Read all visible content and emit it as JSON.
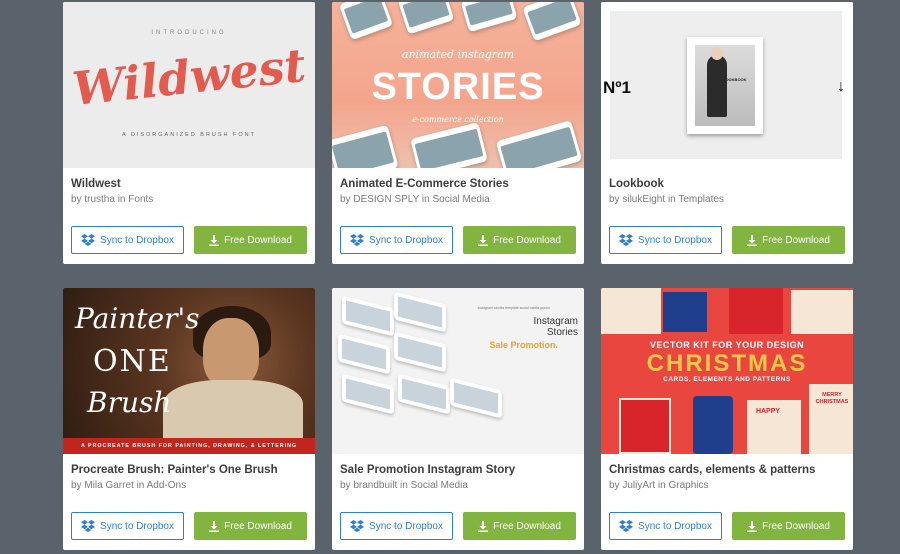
{
  "cards": [
    {
      "title": "Wildwest",
      "author": "trustha",
      "category": "Fonts",
      "sync_label": "Sync to Dropbox",
      "download_label": "Free Download",
      "thumb": {
        "intro": "INTRODUCING",
        "headline": "Wildwest",
        "sub": "A DISORGANIZED BRUSH FONT"
      }
    },
    {
      "title": "Animated E-Commerce Stories",
      "author": "DESIGN SPLY",
      "category": "Social Media",
      "sync_label": "Sync to Dropbox",
      "download_label": "Free Download",
      "thumb": {
        "line1": "animated instagram",
        "headline": "STORIES",
        "line3": "e-commerce collection"
      }
    },
    {
      "title": "Lookbook",
      "author": "silukEight",
      "category": "Templates",
      "sync_label": "Sync to Dropbox",
      "download_label": "Free Download",
      "thumb": {
        "number": "Nº1",
        "arrow": "↓",
        "cover": "LOOKBOOK"
      }
    },
    {
      "title": "Procreate Brush: Painter's One Brush",
      "author": "Mila Garret",
      "category": "Add-Ons",
      "sync_label": "Sync to Dropbox",
      "download_label": "Free Download",
      "thumb": {
        "w1": "Painter's",
        "w2": "ONE",
        "w3": "Brush",
        "banner": "A PROCREATE BRUSH FOR PAINTING, DRAWING, & LETTERING"
      }
    },
    {
      "title": "Sale Promotion Instagram Story",
      "author": "brandbuilt",
      "category": "Social Media",
      "sync_label": "Sync to Dropbox",
      "download_label": "Free Download",
      "thumb": {
        "small": "instagram stories template social media promo",
        "line1": "Instagram",
        "line2": "Stories",
        "promo": "Sale Promotion."
      }
    },
    {
      "title": "Christmas cards, elements & patterns",
      "author": "JuliyArt",
      "category": "Graphics",
      "sync_label": "Sync to Dropbox",
      "download_label": "Free Download",
      "thumb": {
        "kit": "VECTOR KIT FOR YOUR DESIGN",
        "big": "CHRISTMAS",
        "sub": "CARDS, ELEMENTS AND PATTERNS",
        "sign1": "MERRY",
        "sign2": "CHRISTMAS",
        "happy": "HAPPY"
      }
    }
  ],
  "by_word": "by",
  "in_word": "in",
  "colors": {
    "background": "#5a636b",
    "dropbox_blue": "#2f7fd2",
    "download_green": "#82b440"
  }
}
